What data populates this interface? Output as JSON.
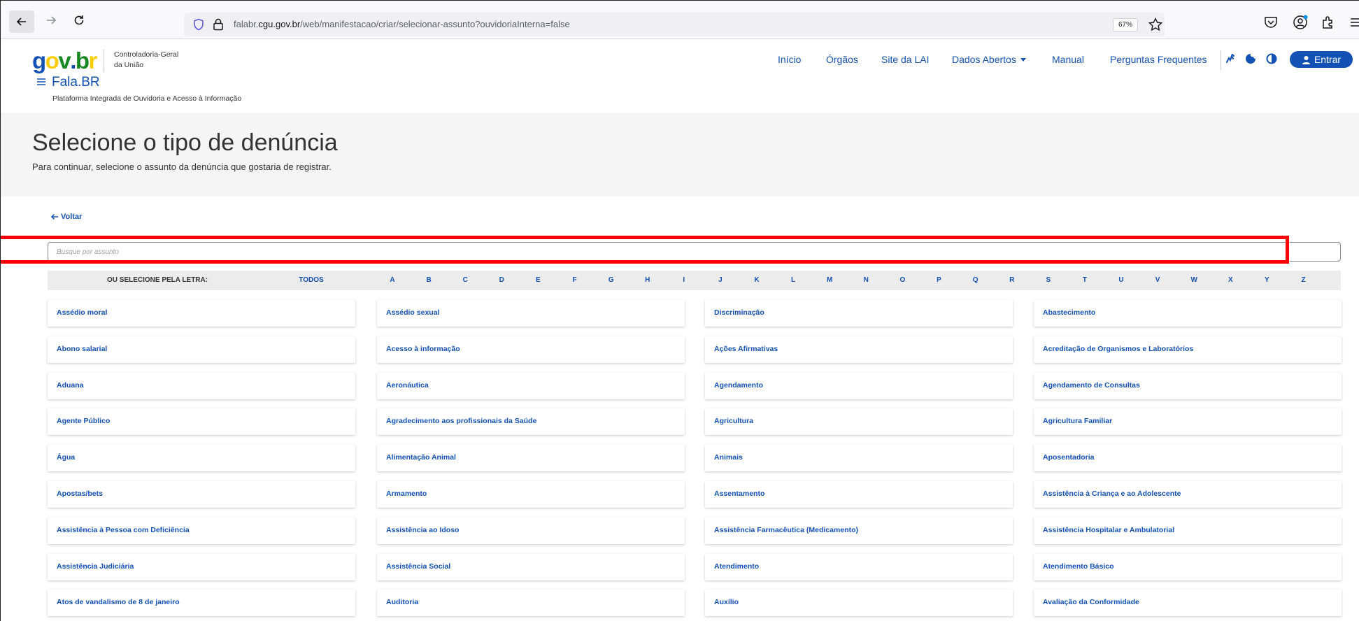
{
  "browser": {
    "url_prefix": "falabr.",
    "url_host": "cgu.gov.br",
    "url_path": "/web/manifestacao/criar/selecionar-assunto?ouvidoriaInterna=false",
    "zoom": "67%"
  },
  "header": {
    "logo_parts": [
      "g",
      "o",
      "v",
      ".",
      "b",
      "r"
    ],
    "org_line1": "Controladoria-Geral",
    "org_line2": "da União",
    "brand": "Fala.BR",
    "tagline": "Plataforma Integrada de Ouvidoria e Acesso à Informação",
    "nav": [
      "Início",
      "Órgãos",
      "Site da LAI",
      "Dados Abertos",
      "Manual",
      "Perguntas Frequentes"
    ],
    "login_label": "Entrar"
  },
  "hero": {
    "title": "Selecione o tipo de denúncia",
    "subtitle": "Para continuar, selecione o assunto da denúncia que gostaria de registrar."
  },
  "back_label": "Voltar",
  "search": {
    "placeholder": "Busque por assunto"
  },
  "letter_bar": {
    "label": "OU SELECIONE PELA LETRA:",
    "all": "TODOS",
    "letters": [
      "A",
      "B",
      "C",
      "D",
      "E",
      "F",
      "G",
      "H",
      "I",
      "J",
      "K",
      "L",
      "M",
      "N",
      "O",
      "P",
      "Q",
      "R",
      "S",
      "T",
      "U",
      "V",
      "W",
      "X",
      "Y",
      "Z"
    ]
  },
  "subjects": [
    [
      "Assédio moral",
      "Assédio sexual",
      "Discriminação",
      "Abastecimento"
    ],
    [
      "Abono salarial",
      "Acesso à informação",
      "Ações Afirmativas",
      "Acreditação de Organismos e Laboratórios"
    ],
    [
      "Aduana",
      "Aeronáutica",
      "Agendamento",
      "Agendamento de Consultas"
    ],
    [
      "Agente Público",
      "Agradecimento aos profissionais da Saúde",
      "Agricultura",
      "Agricultura Familiar"
    ],
    [
      "Água",
      "Alimentação Animal",
      "Animais",
      "Aposentadoria"
    ],
    [
      "Apostas/bets",
      "Armamento",
      "Assentamento",
      "Assistência à Criança e ao Adolescente"
    ],
    [
      "Assistência à Pessoa com Deficiência",
      "Assistência ao Idoso",
      "Assistência Farmacêutica (Medicamento)",
      "Assistência Hospitalar e Ambulatorial"
    ],
    [
      "Assistência Judiciária",
      "Assistência Social",
      "Atendimento",
      "Atendimento Básico"
    ],
    [
      "Atos de vandalismo de 8 de janeiro",
      "Auditoria",
      "Auxílio",
      "Avaliação da Conformidade"
    ]
  ],
  "colors": {
    "primary_blue": "#1351b4",
    "logo_green": "#168821",
    "logo_blue": "#1351b4",
    "logo_yellow": "#ffcd07",
    "highlight_red": "#ff0000"
  }
}
